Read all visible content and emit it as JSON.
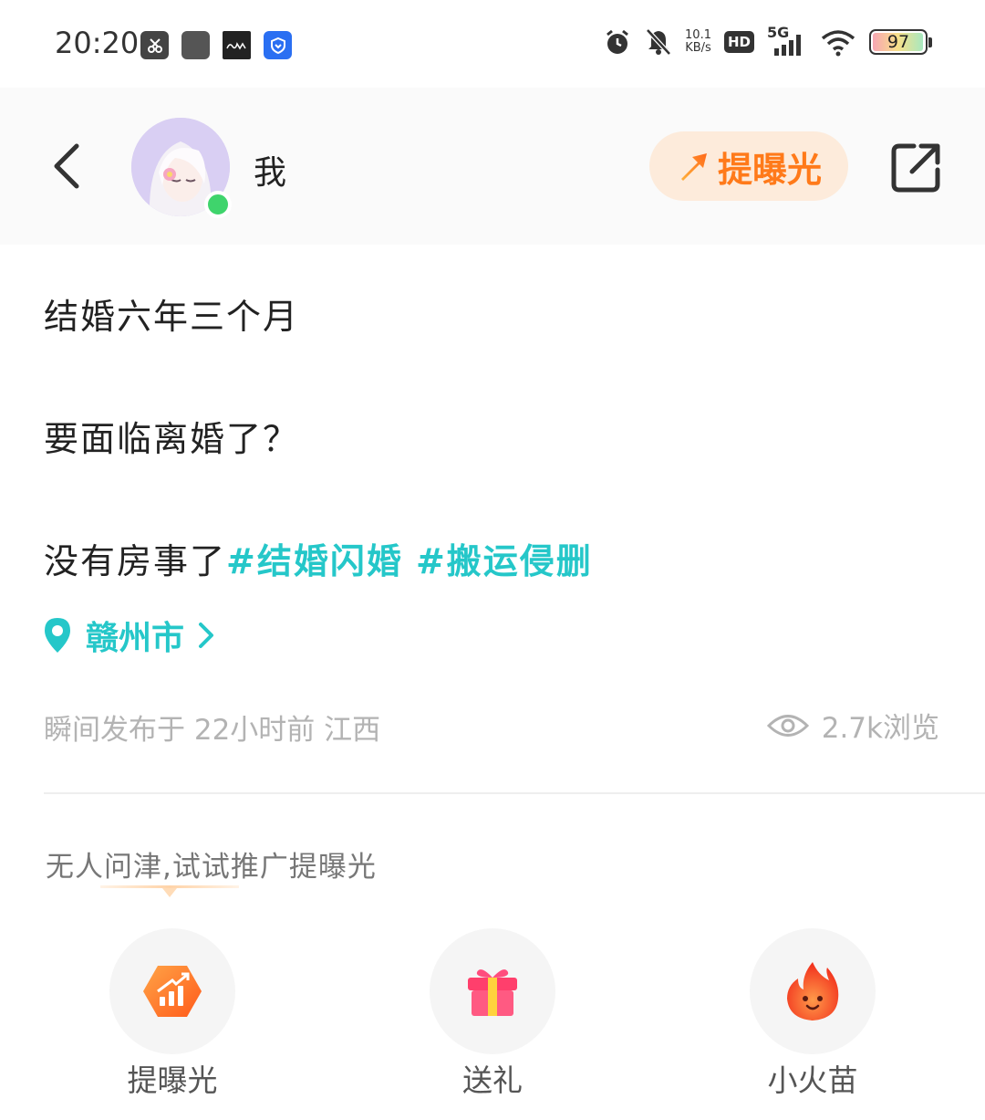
{
  "status_bar": {
    "time": "20:20",
    "net_speed_value": "10.1",
    "net_speed_unit": "KB/s",
    "hd_label": "HD",
    "network_label": "5G",
    "battery_level": "97"
  },
  "header": {
    "username": "我",
    "boost_label": "提曝光"
  },
  "post": {
    "line1": "结婚六年三个月",
    "line2": "要面临离婚了？",
    "line3_text": "没有房事了",
    "tags": [
      "#结婚闪婚",
      "#搬运侵删"
    ],
    "location": "赣州市",
    "meta": "瞬间发布于 22小时前 江西",
    "views": "2.7k浏览"
  },
  "promo": {
    "hint": "无人问津,试试推广提曝光"
  },
  "actions": [
    {
      "label": "提曝光",
      "icon": "boost-chart-icon"
    },
    {
      "label": "送礼",
      "icon": "gift-icon"
    },
    {
      "label": "小火苗",
      "icon": "flame-icon"
    }
  ],
  "colors": {
    "accent_teal": "#25c7c9",
    "accent_orange": "#ff7a1a",
    "online_green": "#3fd46c"
  }
}
